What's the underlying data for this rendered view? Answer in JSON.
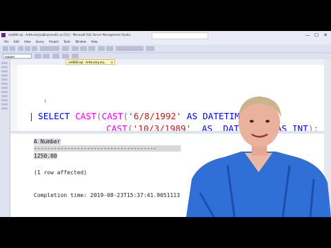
{
  "window": {
    "title": "net666.sql - ArtHursky\\sqlExpress01.sa (51)) - Microsoft SQL Server Management Studio",
    "controls": [
      "—",
      "☐",
      "✕"
    ]
  },
  "menu": [
    "File",
    "Edit",
    "View",
    "Query",
    "Project",
    "Tools",
    "Window",
    "Help"
  ],
  "toolbar": {
    "database": "master",
    "execute": "Execute"
  },
  "tab": {
    "label": "net666.sql - ArtHursky.ma...",
    "close": "✕"
  },
  "editor": {
    "line1": {
      "kw_select": "SELECT ",
      "fn_cast1": "CAST",
      "p1": "(",
      "fn_cast2": "CAST",
      "p2": "(",
      "str1": "'6/8/1992'",
      "as1": " AS ",
      "type1": "DATETIME",
      "p3": ")",
      "minus": " -"
    },
    "line2": {
      "fn_cast3": "CAST",
      "p1": "(",
      "str2": "'10/3/1989'",
      "as2": "  AS  ",
      "type2": "DATETIME",
      "p2": ")",
      "as3": " AS ",
      "type3": "INT",
      "p3": ");"
    }
  },
  "results": {
    "column_header": "A Number",
    "separator": "-------------------------------------",
    "value": "1250.00",
    "rows_affected": "(1 row affected)",
    "completion": "Completion time: 2019-08-23T15:37:41.9051113"
  },
  "colors": {
    "keyword": "#0000ff",
    "function": "#ff00ff",
    "string": "#c41a16",
    "operator": "#808080",
    "ssms_purple": "#68217a"
  }
}
